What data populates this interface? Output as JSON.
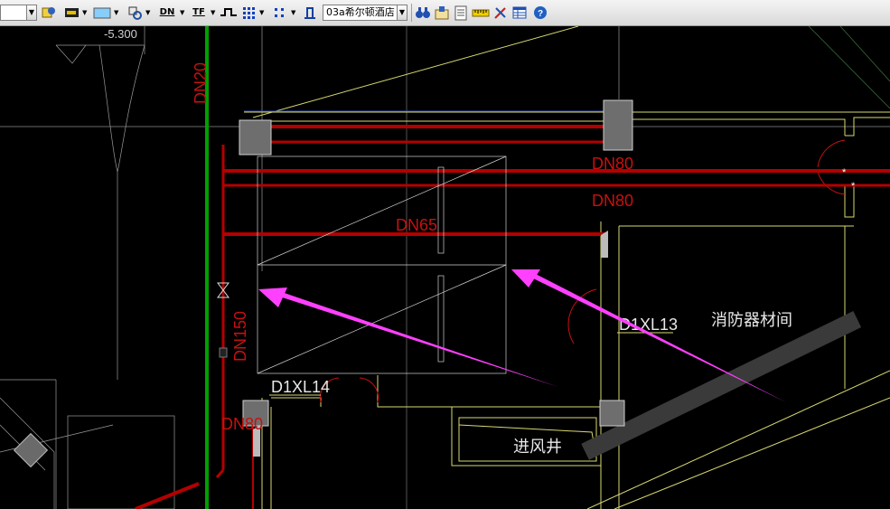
{
  "toolbar": {
    "layer_combo_value": "",
    "color_swatch": "#87cefa",
    "dn_label": "DN",
    "tf_label": "TF",
    "text_style_value": "03a希尔顿酒店"
  },
  "drawing": {
    "elevation_label": "-5.300",
    "pipe_labels": {
      "dn20": "DN20",
      "dn80_top": "DN80",
      "dn80_bottom": "DN80",
      "dn65": "DN65",
      "dn150": "DN150",
      "dn_partial": "DN80"
    },
    "tag_d1xl13": "D1XL13",
    "tag_d1xl14": "D1XL14",
    "room_fire_equipment": "消防器材间",
    "room_air_shaft": "进风井"
  },
  "colors": {
    "background": "#000000",
    "pipe_red": "#b40000",
    "pipe_green": "#00a000",
    "wall_yellow": "#d8d870",
    "arrow_magenta": "#ff40ff",
    "label_red": "#c81010",
    "text_white": "#e8e8e8"
  }
}
